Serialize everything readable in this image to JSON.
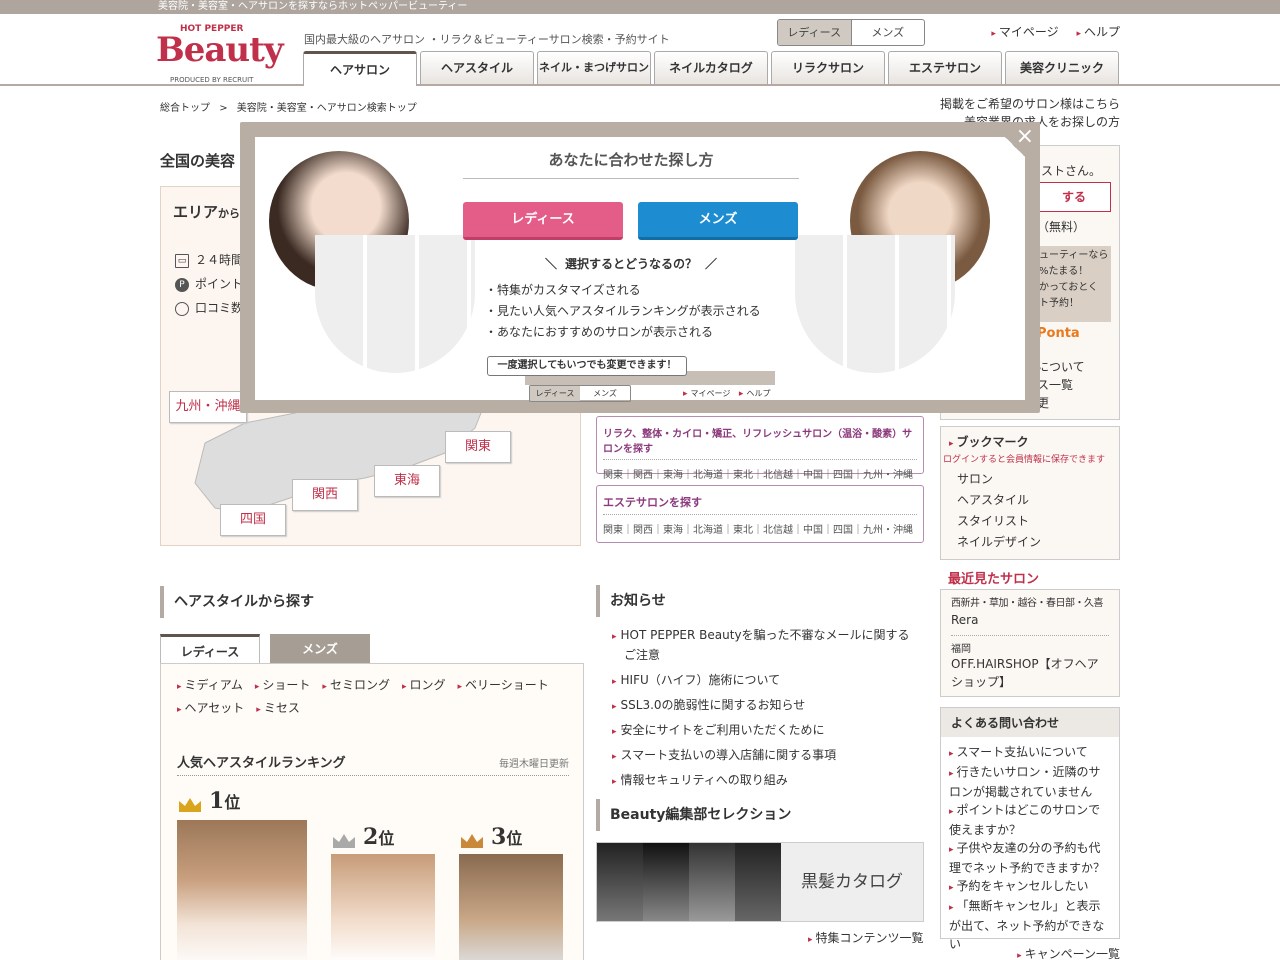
{
  "topbar": {
    "text": "美容院・美容室・ヘアサロンを探すならホットペッパービューティー"
  },
  "logo": {
    "hot_pepper": "HOT PEPPER",
    "beauty": "Beauty",
    "produced": "PRODUCED BY RECRUIT"
  },
  "header": {
    "tagline": "国内最大級のヘアサロン ・リラク＆ビューティーサロン検索・予約サイト",
    "gender": [
      "レディース",
      "メンズ"
    ],
    "links": [
      "マイページ",
      "ヘルプ"
    ],
    "tabs": [
      "ヘアサロン",
      "ヘアスタイル",
      "ネイル・まつげサロン",
      "ネイルカタログ",
      "リラクサロン",
      "エステサロン",
      "美容クリニック"
    ]
  },
  "breadcrumb": {
    "home": "総合トップ",
    "sep": ">",
    "current": "美容院・美容室・ヘアサロン検索トップ"
  },
  "right_links": [
    "掲載をご希望のサロン様はこちら",
    "美容業界の求人をお探しの方"
  ],
  "page_title": "全国の美容",
  "area": {
    "title": "エリア",
    "title_suffix": "から",
    "features": [
      "２４時間",
      "ポイント",
      "口コミ数"
    ],
    "regions": [
      "九州・沖縄",
      "関東",
      "東海",
      "関西",
      "四国"
    ]
  },
  "search_boxes": [
    {
      "title": "リラク、整体・カイロ・矯正、リフレッシュサロン（温浴・酸素）サロンを探す",
      "links": "関東｜関西｜東海｜北海道｜東北｜北信越｜中国｜四国｜九州・沖縄"
    },
    {
      "title": "エステサロンを探す",
      "links": "関東｜関西｜東海｜北海道｜東北｜北信越｜中国｜四国｜九州・沖縄"
    }
  ],
  "sidebar": {
    "greeting": "ストさん。",
    "login_btn": "する",
    "free": "（無料）",
    "promo": [
      "ューティーなら",
      "%たまる！",
      "かっておとく",
      "ト予約！"
    ],
    "ponta": "Ponta",
    "links": [
      "について",
      "ス一覧",
      "更"
    ],
    "bookmark_title": "ブックマーク",
    "bookmark_note": "ログインすると会員情報に保存できます",
    "bookmark_items": [
      "サロン",
      "ヘアスタイル",
      "スタイリスト",
      "ネイルデザイン"
    ],
    "recent_title": "最近見たサロン",
    "recent": [
      {
        "area": "西新井・草加・越谷・春日部・久喜",
        "name": "Rera"
      },
      {
        "area": "福岡",
        "name": "OFF.HAIRSHOP【オフヘアショップ】"
      }
    ],
    "faq_title": "よくある問い合わせ",
    "faq": [
      "スマート支払いについて",
      "行きたいサロン・近隣のサロンが掲載されていません",
      "ポイントはどこのサロンで使えますか？",
      "子供や友達の分の予約も代理でネット予約できますか？",
      "予約をキャンセルしたい",
      "「無断キャンセル」と表示が出て、ネット予約ができない"
    ],
    "campaign": "キャンペーン一覧"
  },
  "hairstyle": {
    "title": "ヘアスタイルから探す",
    "tabs": [
      "レディース",
      "メンズ"
    ],
    "links": [
      "ミディアム",
      "ショート",
      "セミロング",
      "ロング",
      "ベリーショート",
      "ヘアセット",
      "ミセス"
    ],
    "ranking_title": "人気ヘアスタイルランキング",
    "ranking_update": "毎週木曜日更新",
    "ranks": [
      {
        "num": "1",
        "suffix": "位"
      },
      {
        "num": "2",
        "suffix": "位"
      },
      {
        "num": "3",
        "suffix": "位"
      }
    ]
  },
  "news": {
    "title": "お知らせ",
    "items": [
      "HOT PEPPER Beautyを騙った不審なメールに関するご注意",
      "HIFU（ハイフ）施術について",
      "SSL3.0の脆弱性に関するお知らせ",
      "安全にサイトをご利用いただくために",
      "スマート支払いの導入店舗に関する事項",
      "情報セキュリティへの取り組み"
    ]
  },
  "editorial": {
    "title": "Beauty編集部セレクション",
    "banner": "黒髪カタログ",
    "more": "特集コンテンツ一覧"
  },
  "overlay": {
    "title": "あなたに合わせた探し方",
    "ladies_btn": "レディース",
    "mens_btn": "メンズ",
    "question": "選択するとどうなるの？",
    "bullets": [
      "・特集がカスタマイズされる",
      "・見たい人気ヘアスタイルランキングが表示される",
      "・あなたにおすすめのサロンが表示される"
    ],
    "note": "一度選択してもいつでも変更できます！",
    "mini_switch": [
      "レディース",
      "メンズ"
    ],
    "mini_links": [
      "マイページ",
      "ヘルプ"
    ],
    "close": "×"
  },
  "colors": {
    "brand": "#c0304a",
    "ladies": "#e45c88",
    "mens": "#1d8cd0",
    "overlay_frame": "#b8aea4"
  }
}
